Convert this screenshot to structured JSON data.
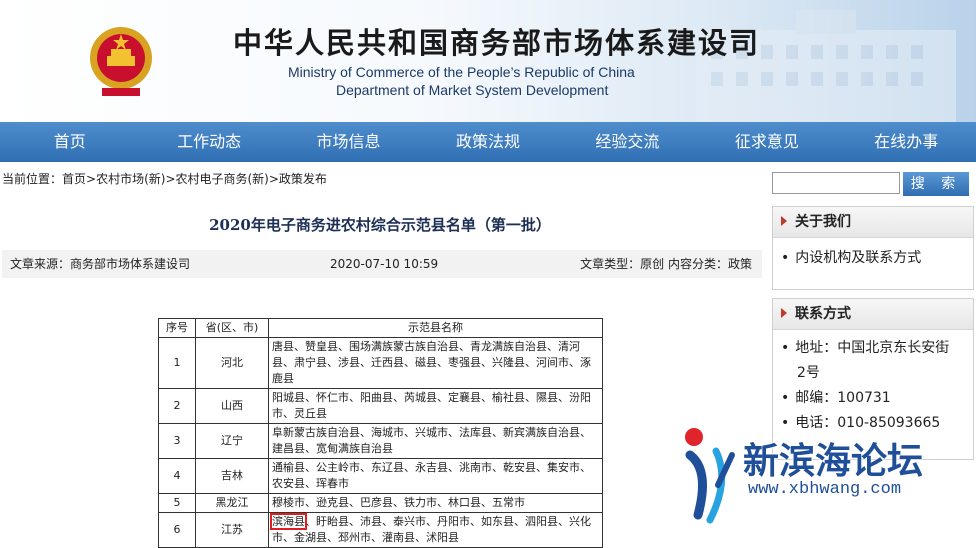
{
  "header": {
    "title": "中华人民共和国商务部市场体系建设司",
    "en_line1": "Ministry of Commerce of the People’s Republic of China",
    "en_line2": "Department of Market System Development"
  },
  "nav": [
    "首页",
    "工作动态",
    "市场信息",
    "政策法规",
    "经验交流",
    "征求意见",
    "在线办事"
  ],
  "breadcrumb": {
    "prefix": "当前位置：",
    "items": [
      "首页>",
      "农村市场(新)>",
      "农村电子商务(新)>",
      "政策发布"
    ]
  },
  "search": {
    "button": "搜 索"
  },
  "article": {
    "title": "2020年电子商务进农村综合示范县名单（第一批）",
    "source": "文章来源：商务部市场体系建设司",
    "date": "2020-07-10 10:59",
    "type": "文章类型：原创 内容分类：政策"
  },
  "sidebar": {
    "about_title": "关于我们",
    "about_items": [
      "内设机构及联系方式"
    ],
    "contact_title": "联系方式",
    "contact_lines": [
      "地址：中国北京东长安街",
      "2号",
      "邮编：100731",
      "电话：010-85093665"
    ]
  },
  "table": {
    "headers": [
      "序号",
      "省(区、市)",
      "示范县名称"
    ],
    "rows": [
      {
        "no": "1",
        "province": "河北",
        "counties": "唐县、赞皇县、围场满族蒙古族自治县、青龙满族自治县、清河县、肃宁县、涉县、迁西县、磁县、枣强县、兴隆县、河间市、涿鹿县"
      },
      {
        "no": "2",
        "province": "山西",
        "counties": "阳城县、怀仁市、阳曲县、芮城县、定襄县、榆社县、隰县、汾阳市、灵丘县"
      },
      {
        "no": "3",
        "province": "辽宁",
        "counties": "阜新蒙古族自治县、海城市、兴城市、法库县、新宾满族自治县、建昌县、宽甸满族自治县"
      },
      {
        "no": "4",
        "province": "吉林",
        "counties": "通榆县、公主岭市、东辽县、永吉县、洮南市、乾安县、集安市、农安县、珲春市"
      },
      {
        "no": "5",
        "province": "黑龙江",
        "counties": "穆棱市、逊克县、巴彦县、铁力市、林口县、五常市"
      },
      {
        "no": "6",
        "province": "江苏",
        "first": "滨海县",
        "counties": "、盱眙县、沛县、泰兴市、丹阳市、如东县、泗阳县、兴化市、金湖县、邳州市、灌南县、沭阳县"
      }
    ]
  },
  "watermark": {
    "text": "新滨海论坛",
    "url": "www.xbhwang.com"
  },
  "colors": {
    "nav": "#2f6fb3",
    "title": "#1e2f55",
    "highlight": "#e02020"
  }
}
